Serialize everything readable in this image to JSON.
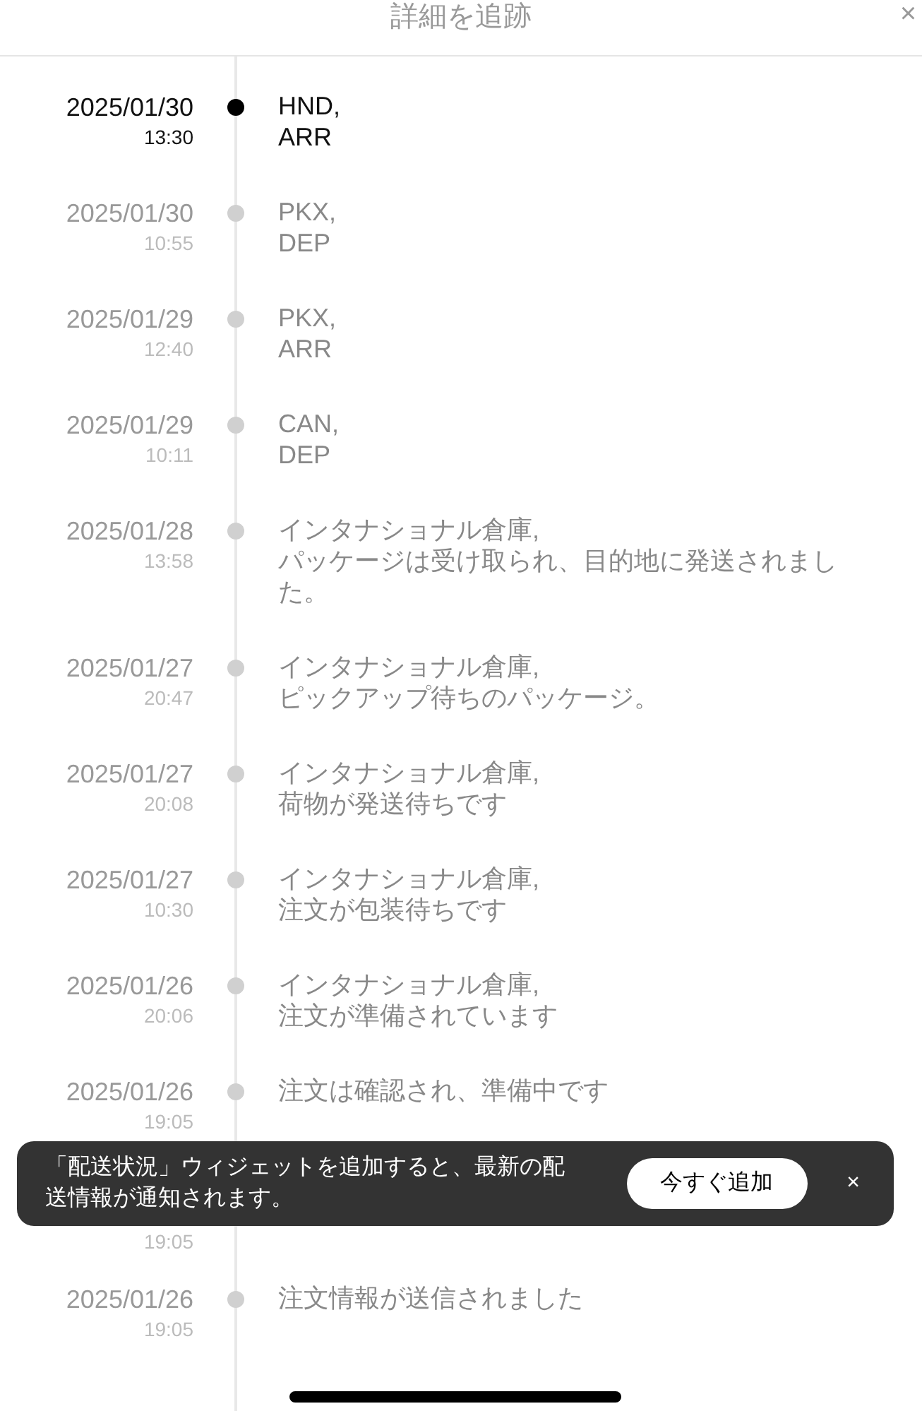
{
  "header": {
    "title": "詳細を追跡",
    "close": "×"
  },
  "events": [
    {
      "date": "2025/01/30",
      "time": "13:30",
      "lines": [
        "HND,",
        "ARR"
      ],
      "current": true
    },
    {
      "date": "2025/01/30",
      "time": "10:55",
      "lines": [
        "PKX,",
        "DEP"
      ],
      "current": false
    },
    {
      "date": "2025/01/29",
      "time": "12:40",
      "lines": [
        "PKX,",
        "ARR"
      ],
      "current": false
    },
    {
      "date": "2025/01/29",
      "time": "10:11",
      "lines": [
        "CAN,",
        "DEP"
      ],
      "current": false
    },
    {
      "date": "2025/01/28",
      "time": "13:58",
      "lines": [
        "インタナショナル倉庫,",
        "パッケージは受け取られ、目的地に発送されました。"
      ],
      "current": false
    },
    {
      "date": "2025/01/27",
      "time": "20:47",
      "lines": [
        "インタナショナル倉庫,",
        "ピックアップ待ちのパッケージ。"
      ],
      "current": false
    },
    {
      "date": "2025/01/27",
      "time": "20:08",
      "lines": [
        "インタナショナル倉庫,",
        "荷物が発送待ちです"
      ],
      "current": false
    },
    {
      "date": "2025/01/27",
      "time": "10:30",
      "lines": [
        "インタナショナル倉庫,",
        "注文が包装待ちです"
      ],
      "current": false
    },
    {
      "date": "2025/01/26",
      "time": "20:06",
      "lines": [
        "インタナショナル倉庫,",
        "注文が準備されています"
      ],
      "current": false
    },
    {
      "date": "2025/01/26",
      "time": "19:05",
      "lines": [
        "注文は確認され、準備中です"
      ],
      "current": false
    },
    {
      "time": "19:05"
    },
    {
      "date": "2025/01/26",
      "time": "19:05",
      "lines": [
        "注文情報が送信されました"
      ],
      "current": false
    }
  ],
  "toast": {
    "message": "「配送状況」ウィジェットを追加すると、最新の配送情報が通知されます。",
    "button": "今すぐ追加",
    "close": "×"
  }
}
